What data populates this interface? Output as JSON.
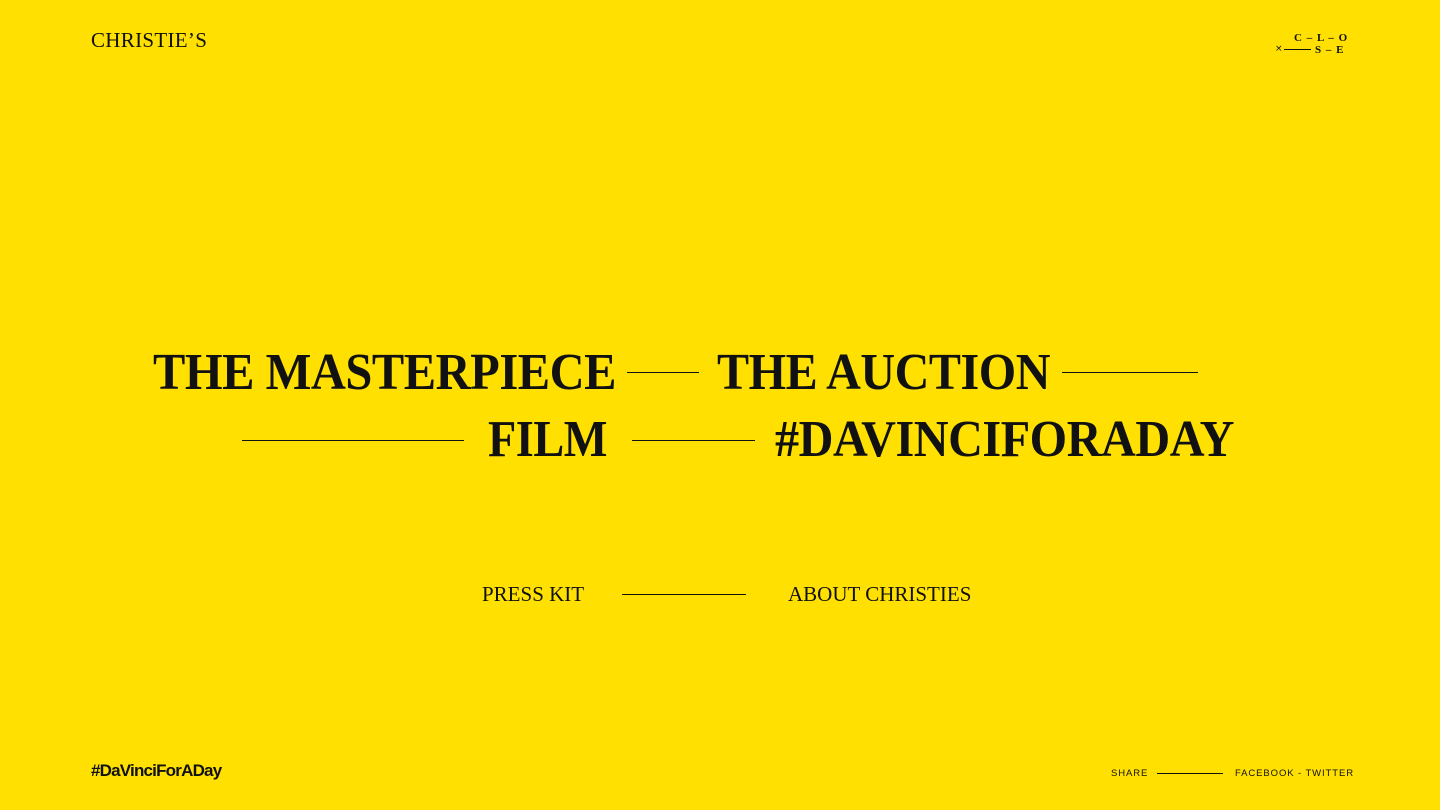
{
  "header": {
    "logo": "CHRISTIE’S",
    "close": {
      "x": "×",
      "row1": "C – L – O",
      "row2": "S – E"
    }
  },
  "nav": {
    "masterpiece": "THE MASTERPIECE",
    "auction": "THE AUCTION",
    "film": "FILM",
    "hashtag": "#DAVINCIFORADAY"
  },
  "subnav": {
    "press_kit": "PRESS KIT",
    "about": "ABOUT CHRISTIES"
  },
  "footer": {
    "hashtag": "#DaVinciForADay",
    "share_label": "SHARE",
    "facebook": "FACEBOOK",
    "separator": " - ",
    "twitter": "TWITTER"
  },
  "colors": {
    "background": "#FFE000",
    "text": "#111111"
  }
}
